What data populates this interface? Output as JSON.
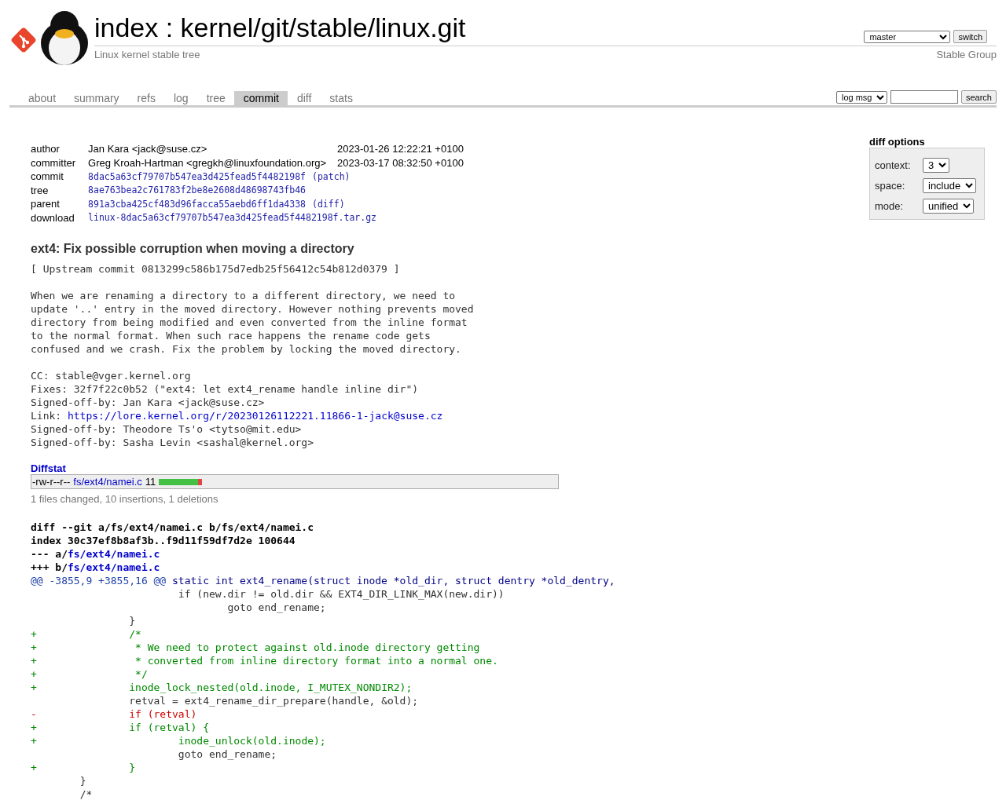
{
  "header": {
    "title": "index : kernel/git/stable/linux.git",
    "description": "Linux kernel stable tree",
    "branch_select": "master",
    "switch_button": "switch",
    "owner": "Stable Group"
  },
  "tabs": [
    {
      "label": "about",
      "selected": false
    },
    {
      "label": "summary",
      "selected": false
    },
    {
      "label": "refs",
      "selected": false
    },
    {
      "label": "log",
      "selected": false
    },
    {
      "label": "tree",
      "selected": false
    },
    {
      "label": "commit",
      "selected": true
    },
    {
      "label": "diff",
      "selected": false
    },
    {
      "label": "stats",
      "selected": false
    }
  ],
  "search": {
    "scope": "log msg",
    "button": "search"
  },
  "commit_info": [
    {
      "label": "author",
      "value": "Jan Kara <jack@suse.cz>",
      "date": "2023-01-26 12:22:21 +0100",
      "kind": "person"
    },
    {
      "label": "committer",
      "value": "Greg Kroah-Hartman <gregkh@linuxfoundation.org>",
      "date": "2023-03-17 08:32:50 +0100",
      "kind": "person"
    },
    {
      "label": "commit",
      "value": "8dac5a63cf79707b547ea3d425fead5f4482198f",
      "extra": "(patch)",
      "kind": "hash"
    },
    {
      "label": "tree",
      "value": "8ae763bea2c761783f2be8e2608d48698743fb46",
      "kind": "hash"
    },
    {
      "label": "parent",
      "value": "891a3cba425cf483d96facca55aebd6ff1da4338",
      "extra": "(diff)",
      "kind": "hash"
    },
    {
      "label": "download",
      "value": "linux-8dac5a63cf79707b547ea3d425fead5f4482198f.tar.gz",
      "kind": "hash"
    }
  ],
  "diff_options": {
    "title": "diff options",
    "rows": [
      {
        "label": "context:",
        "value": "3"
      },
      {
        "label": "space:",
        "value": "include"
      },
      {
        "label": "mode:",
        "value": "unified"
      }
    ]
  },
  "subject": "ext4: Fix possible corruption when moving a directory",
  "message": [
    {
      "text": "[ Upstream commit 0813299c586b175d7edb25f56412c54b812d0379 ]"
    },
    {
      "text": "When we are renaming a directory to a different directory, we need to\nupdate '..' entry in the moved directory. However nothing prevents moved\ndirectory from being modified and even converted from the inline format\nto the normal format. When such race happens the rename code gets\nconfused and we crash. Fix the problem by locking the moved directory."
    },
    {
      "text": "CC: stable@vger.kernel.org\nFixes: 32f7f22c0b52 (\"ext4: let ext4_rename handle inline dir\")\nSigned-off-by: Jan Kara <jack@suse.cz>",
      "link_prefix": "Link: ",
      "link": "https://lore.kernel.org/r/20230126112221.11866-1-jack@suse.cz",
      "after": "Signed-off-by: Theodore Ts'o <tytso@mit.edu>\nSigned-off-by: Sasha Levin <sashal@kernel.org>"
    }
  ],
  "diffstat": {
    "title": "Diffstat",
    "files": [
      {
        "mode": "-rw-r--r--",
        "path": "fs/ext4/namei.c",
        "count": "11",
        "level": 0.91
      }
    ],
    "summary": "1 files changed, 10 insertions, 1 deletions"
  },
  "diff": [
    {
      "kind": "head",
      "text": "diff --git a/fs/ext4/namei.c b/fs/ext4/namei.c"
    },
    {
      "kind": "head",
      "text": "index 30c37ef8b8af3b..f9d11f59df7d2e 100644"
    },
    {
      "kind": "file",
      "text": "--- a/",
      "path": "fs/ext4/namei.c"
    },
    {
      "kind": "file",
      "text": "+++ b/",
      "path": "fs/ext4/namei.c"
    },
    {
      "kind": "hunk",
      "text": "@@ -3855,9 +3855,16 @@",
      "context": " static int ext4_rename(struct inode *old_dir, struct dentry *old_dentry,"
    },
    {
      "kind": "ctx",
      "text": " \t\t\tif (new.dir != old.dir && EXT4_DIR_LINK_MAX(new.dir))"
    },
    {
      "kind": "ctx",
      "text": " \t\t\t\tgoto end_rename;"
    },
    {
      "kind": "ctx",
      "text": " \t\t}"
    },
    {
      "kind": "add",
      "text": "+\t\t/*"
    },
    {
      "kind": "add",
      "text": "+\t\t * We need to protect against old.inode directory getting"
    },
    {
      "kind": "add",
      "text": "+\t\t * converted from inline directory format into a normal one."
    },
    {
      "kind": "add",
      "text": "+\t\t */"
    },
    {
      "kind": "add",
      "text": "+\t\tinode_lock_nested(old.inode, I_MUTEX_NONDIR2);"
    },
    {
      "kind": "ctx",
      "text": " \t\tretval = ext4_rename_dir_prepare(handle, &old);"
    },
    {
      "kind": "del",
      "text": "-\t\tif (retval)"
    },
    {
      "kind": "add",
      "text": "+\t\tif (retval) {"
    },
    {
      "kind": "add",
      "text": "+\t\t\tinode_unlock(old.inode);"
    },
    {
      "kind": "ctx",
      "text": " \t\t\tgoto end_rename;"
    },
    {
      "kind": "add",
      "text": "+\t\t}"
    },
    {
      "kind": "ctx",
      "text": " \t}"
    },
    {
      "kind": "ctx",
      "text": " \t/*"
    }
  ]
}
